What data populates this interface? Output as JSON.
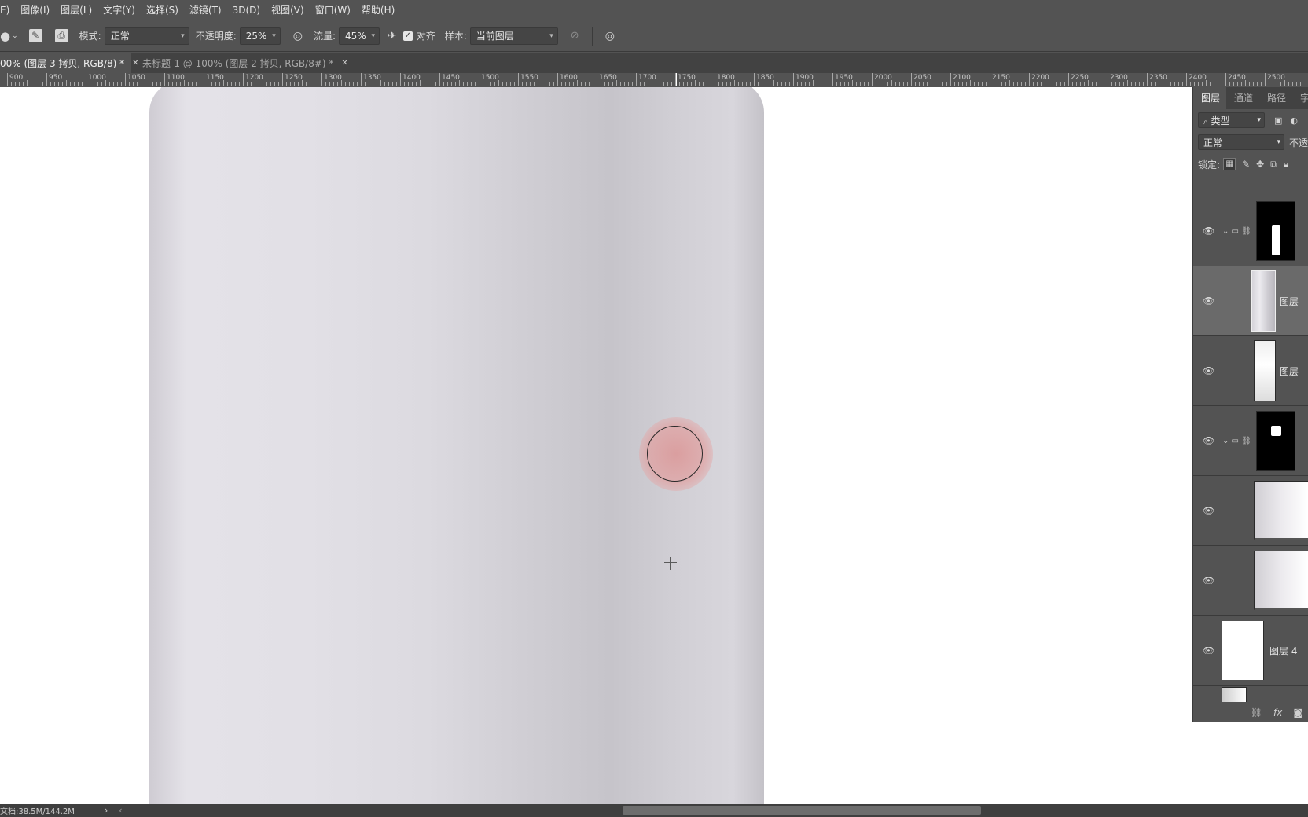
{
  "menu": [
    "E)",
    "图像(I)",
    "图层(L)",
    "文字(Y)",
    "选择(S)",
    "滤镜(T)",
    "3D(D)",
    "视图(V)",
    "窗口(W)",
    "帮助(H)"
  ],
  "options": {
    "mode_label": "模式:",
    "mode_value": "正常",
    "opacity_label": "不透明度:",
    "opacity_value": "25%",
    "flow_label": "流量:",
    "flow_value": "45%",
    "align_label": "对齐",
    "sample_label": "样本:",
    "sample_value": "当前图层"
  },
  "tabs": {
    "active": "00% (图层 3 拷贝, RGB/8) *",
    "inactive": "未标题-1 @ 100% (图层 2 拷贝, RGB/8#) *"
  },
  "ruler": [
    "900",
    "950",
    "1000",
    "1050",
    "1100",
    "1150",
    "1200",
    "1250",
    "1300",
    "1350",
    "1400",
    "1450",
    "1500",
    "1550",
    "1600",
    "1650",
    "1700",
    "1750",
    "1800",
    "1850",
    "1900",
    "1950",
    "2000",
    "2050",
    "2100",
    "2150",
    "2200",
    "2250",
    "2300",
    "2350",
    "2400",
    "2450",
    "2500"
  ],
  "status": {
    "doc": "文档:38.5M/144.2M",
    "arrow": "›"
  },
  "panel": {
    "tabs": [
      "图层",
      "通道",
      "路径",
      "字"
    ],
    "filter_value": "类型",
    "blend_value": "正常",
    "opacity_partial": "不透",
    "lock_label": "锁定:",
    "layers": [
      {
        "name": "",
        "kind": "group-mask"
      },
      {
        "name": "图层",
        "kind": "bottle",
        "selected": true
      },
      {
        "name": "图层",
        "kind": "label"
      },
      {
        "name": "",
        "kind": "group-mask2"
      },
      {
        "name": "",
        "kind": "gradient"
      },
      {
        "name": "",
        "kind": "gradient"
      },
      {
        "name": "图层 4",
        "kind": "white"
      }
    ]
  }
}
